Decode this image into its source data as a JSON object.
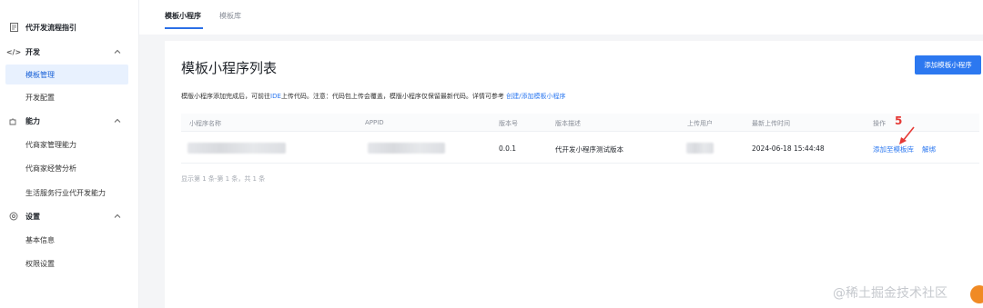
{
  "sidebar": {
    "top_item": "代开发流程指引",
    "groups": [
      {
        "label": "开发",
        "icon": "code-icon",
        "items": [
          "模板管理",
          "开发配置"
        ]
      },
      {
        "label": "能力",
        "icon": "puzzle-icon",
        "items": [
          "代商家管理能力",
          "代商家经营分析",
          "生活服务行业代开发能力"
        ]
      },
      {
        "label": "设置",
        "icon": "settings-icon",
        "items": [
          "基本信息",
          "权限设置"
        ]
      }
    ],
    "active_item": "模板管理"
  },
  "tabs": [
    "模板小程序",
    "模板库"
  ],
  "main": {
    "title": "模板小程序列表",
    "add_button": "添加模板小程序",
    "notice_pre": "模版小程序添加完成后，可前往",
    "notice_ide": "IDE",
    "notice_mid": "上传代码。注意：代码包上传会覆盖，模版小程序仅保留最新代码。详情可参考 ",
    "notice_link": "创建/添加模板小程序"
  },
  "table": {
    "headers": [
      "小程序名称",
      "APPID",
      "版本号",
      "版本描述",
      "上传用户",
      "最新上传时间",
      "操作"
    ],
    "rows": [
      {
        "name": "",
        "appid": "",
        "version": "0.0.1",
        "description": "代开发小程序测试版本",
        "user": "",
        "uploaded_at": "2024-06-18 15:44:48",
        "actions": [
          "添加至模板库",
          "解绑"
        ]
      }
    ],
    "pagination": "显示第 1 条-第 1 条，共 1 条"
  },
  "annotation": {
    "number": "5",
    "color": "#e53935"
  },
  "watermark": "@稀土掘金技术社区",
  "colors": {
    "accent": "#2c78f0",
    "active_bg": "#e8f1fe"
  }
}
